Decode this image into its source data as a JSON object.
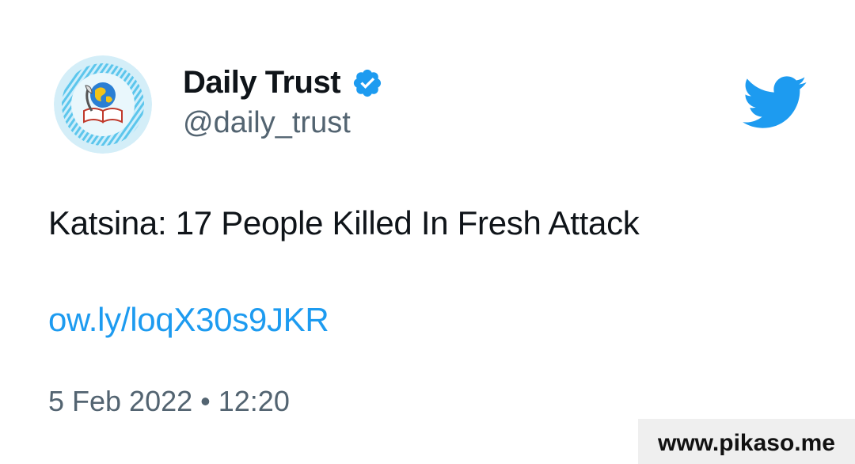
{
  "tweet": {
    "author": {
      "display_name": "Daily Trust",
      "handle": "@daily_trust",
      "verified": true,
      "avatar_icon": "daily-trust-logo"
    },
    "text": "Katsina: 17 People Killed In Fresh Attack",
    "link": "ow.ly/loqX30s9JKR",
    "timestamp": "5 Feb 2022 • 12:20"
  },
  "icons": {
    "verified": "verified-badge-icon",
    "brand": "twitter-bird-icon"
  },
  "colors": {
    "link": "#1d9bf0",
    "brand_blue": "#1d9bf0",
    "secondary_text": "#536471",
    "primary_text": "#0f1419",
    "avatar_ring": "#8fd3ef"
  },
  "watermark": {
    "text": "www.pikaso.me"
  }
}
